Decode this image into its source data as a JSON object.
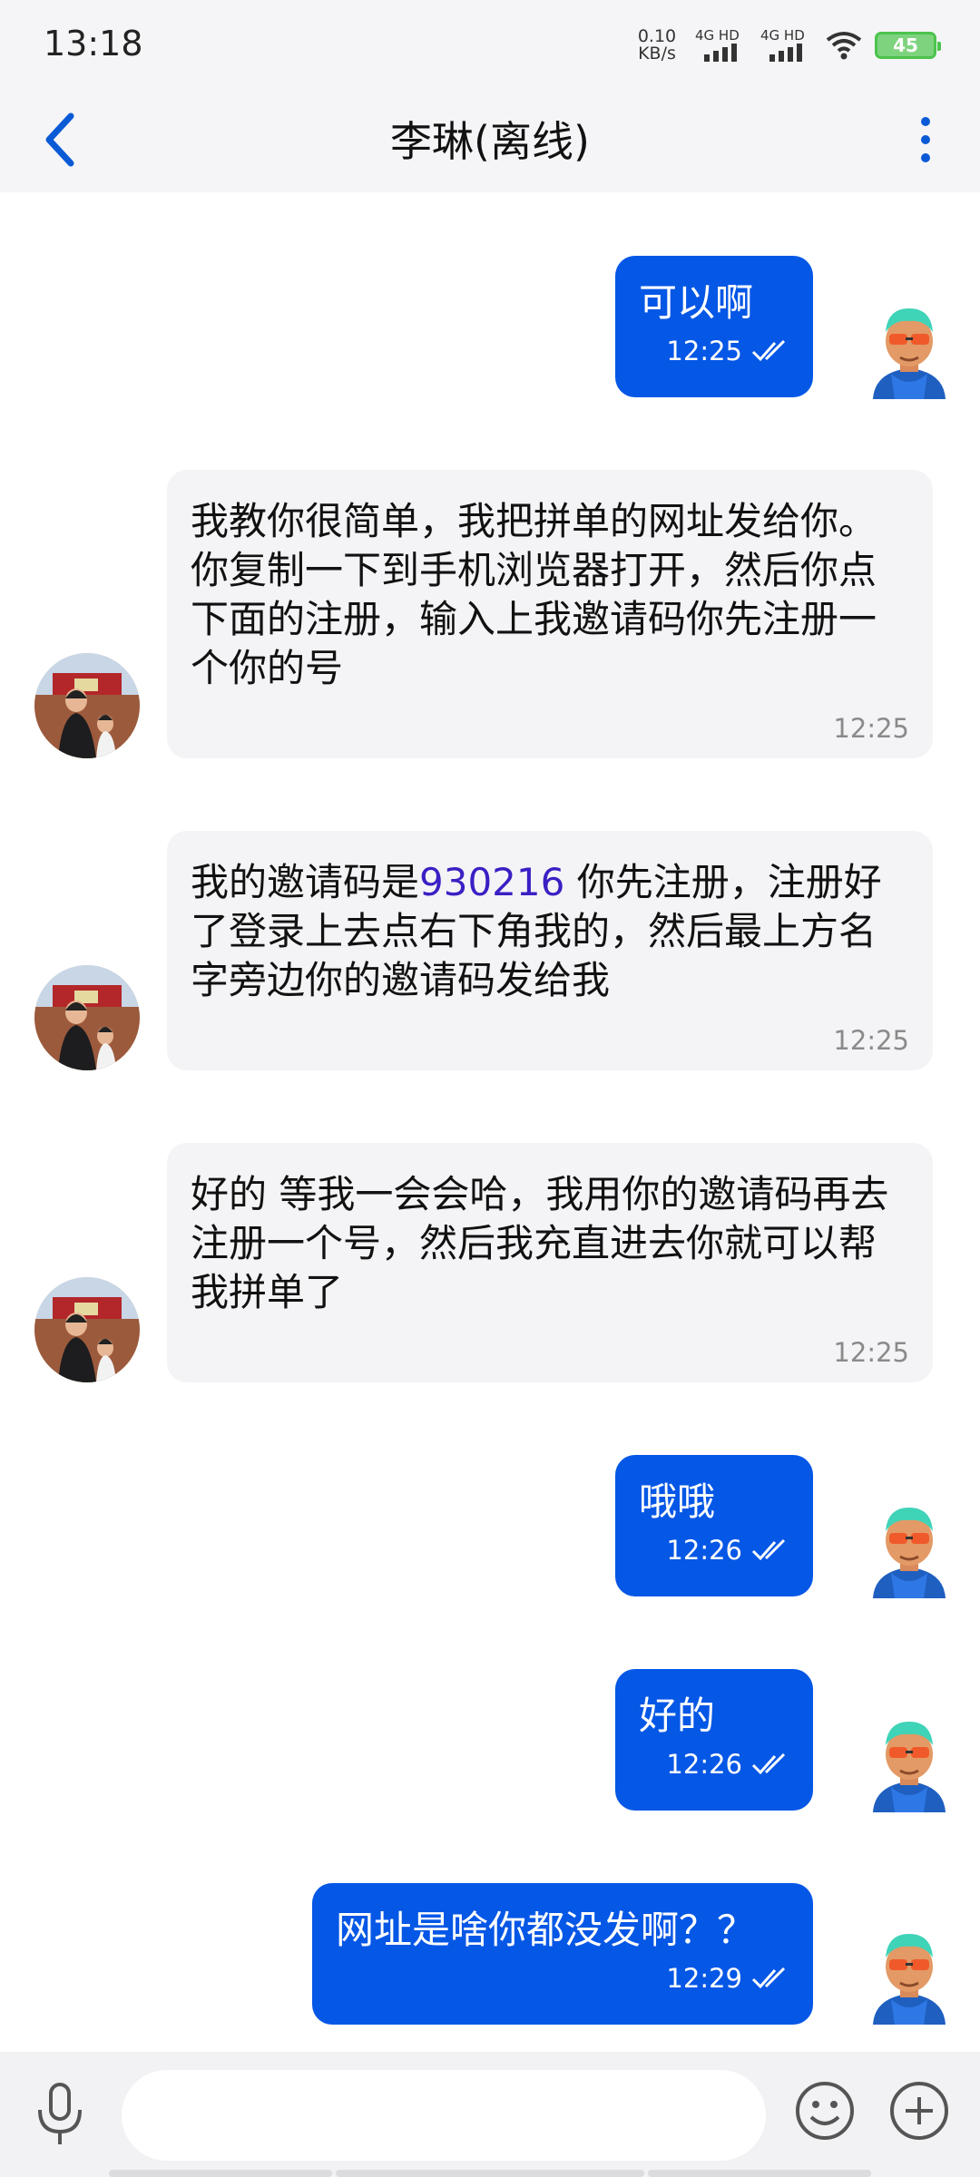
{
  "status_bar": {
    "time": "13:18",
    "net_speed_value": "0.10",
    "net_speed_unit": "KB/s",
    "sim1_label": "4G HD",
    "sim2_label": "4G HD",
    "battery": "45"
  },
  "header": {
    "title": "李琳(离线)"
  },
  "messages": [
    {
      "direction": "out",
      "text": "可以啊",
      "time": "12:25"
    },
    {
      "direction": "in",
      "text": "我教你很简单，我把拼单的网址发给你。你复制一下到手机浏览器打开，然后你点下面的注册，输入上我邀请码你先注册一个你的号",
      "time": "12:25"
    },
    {
      "direction": "in",
      "text_before": "我的邀请码是",
      "code": "930216",
      "text_after": " 你先注册，注册好了登录上去点右下角我的，然后最上方名字旁边你的邀请码发给我",
      "time": "12:25"
    },
    {
      "direction": "in",
      "text": "好的 等我一会会哈，我用你的邀请码再去注册一个号，然后我充直进去你就可以帮我拼单了",
      "time": "12:25"
    },
    {
      "direction": "out",
      "text": "哦哦",
      "time": "12:26"
    },
    {
      "direction": "out",
      "text": "好的",
      "time": "12:26"
    },
    {
      "direction": "out",
      "text": "网址是啥你都没发啊？？",
      "time": "12:29"
    }
  ],
  "input": {
    "value": ""
  },
  "icons": {
    "back": "chevron-left-icon",
    "more": "more-vertical-icon",
    "mic": "microphone-icon",
    "emoji": "smiley-icon",
    "plus": "plus-circle-icon",
    "read": "double-check-icon"
  },
  "colors": {
    "outgoing_bubble": "#0557e6",
    "incoming_bubble": "#f4f4f6",
    "accent": "#0a5ad6",
    "invite_code": "#3a1fc4"
  }
}
